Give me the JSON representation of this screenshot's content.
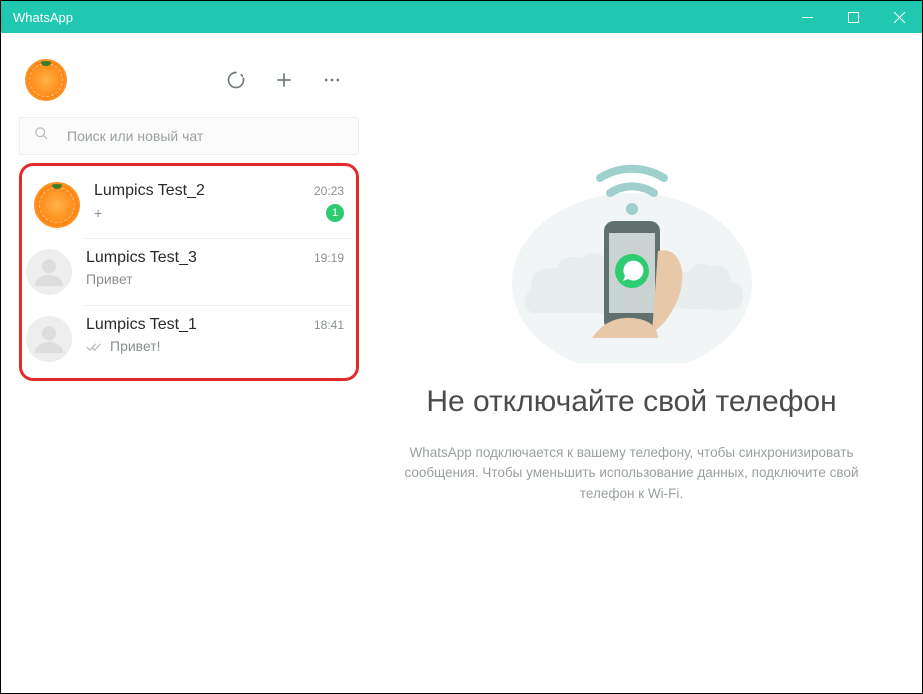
{
  "window": {
    "title": "WhatsApp"
  },
  "search": {
    "placeholder": "Поиск или новый чат"
  },
  "chats": [
    {
      "name": "Lumpics Test_2",
      "time": "20:23",
      "preview": "+",
      "unread": "1",
      "avatar": "orange",
      "checks": false
    },
    {
      "name": "Lumpics Test_3",
      "time": "19:19",
      "preview": "Привет",
      "unread": null,
      "avatar": "blank",
      "checks": false
    },
    {
      "name": "Lumpics Test_1",
      "time": "18:41",
      "preview": "Привет!",
      "unread": null,
      "avatar": "blank",
      "checks": true
    }
  ],
  "intro": {
    "title": "Не отключайте свой телефон",
    "subtitle": "WhatsApp подключается к вашему телефону, чтобы синхронизировать сообщения. Чтобы уменьшить использование данных, подключите свой телефон к Wi-Fi."
  }
}
